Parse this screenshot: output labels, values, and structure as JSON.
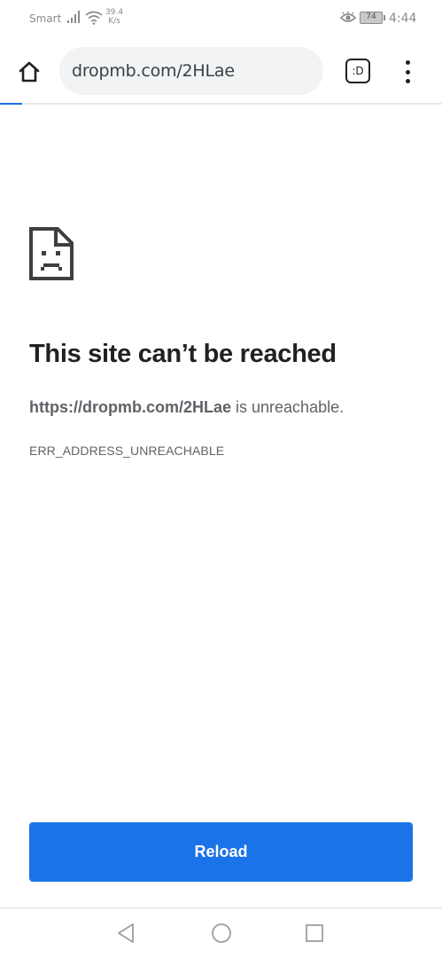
{
  "status_bar": {
    "carrier": "Smart",
    "speed_value": "39.4",
    "speed_unit": "K/s",
    "battery": "74",
    "time": "4:44",
    "icons": [
      "signal-icon",
      "wifi-icon",
      "eye-comfort-icon",
      "battery-icon"
    ]
  },
  "toolbar": {
    "url": "dropmb.com/2HLae",
    "tab_label": ":D",
    "icons": [
      "home-icon",
      "tab-switcher-icon",
      "overflow-menu-icon"
    ]
  },
  "error": {
    "title": "This site can’t be reached",
    "url": "https://dropmb.com/2HLae",
    "desc_suffix": " is unreachable.",
    "code": "ERR_ADDRESS_UNREACHABLE",
    "icon": "sad-page-icon"
  },
  "reload": {
    "label": "Reload"
  },
  "nav": {
    "icons": [
      "back-icon",
      "home-circle-icon",
      "recents-icon"
    ]
  },
  "colors": {
    "accent": "#1a73e8",
    "text_primary": "#202124",
    "text_secondary": "#5f6368",
    "omnibox_bg": "#f1f3f4"
  }
}
